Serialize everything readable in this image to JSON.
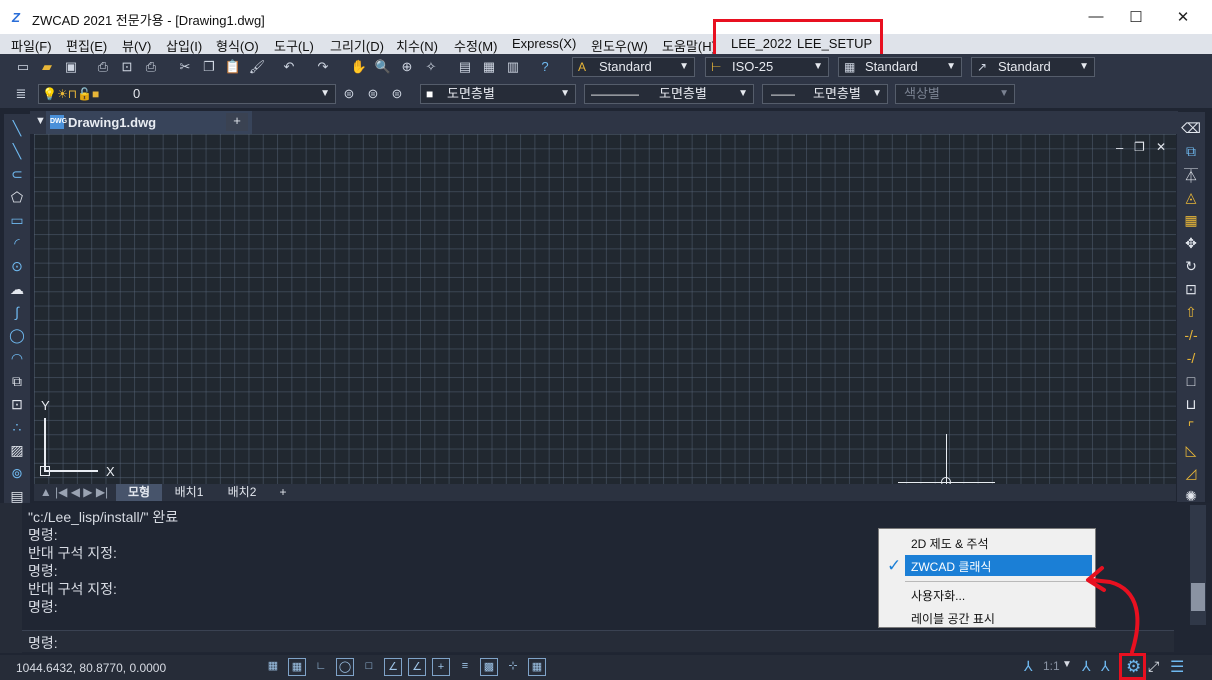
{
  "window": {
    "title": "ZWCAD 2021 전문가용 - [Drawing1.dwg]",
    "min": "—",
    "max": "☐",
    "close": "✕"
  },
  "menu": [
    "파일(F)",
    "편집(E)",
    "뷰(V)",
    "삽입(I)",
    "형식(O)",
    "도구(L)",
    "그리기(D)",
    "치수(N)",
    "수정(M)",
    "Express(X)",
    "윈도우(W)",
    "도움말(H)",
    "LEE_2022",
    "LEE_SETUP"
  ],
  "toolbar1": {
    "text_style": "Standard",
    "dim_style": "ISO-25",
    "table_style": "Standard",
    "mleader_style": "Standard"
  },
  "toolbar2": {
    "layer": "0",
    "color": "도면층별",
    "linetype": "도면층별",
    "lineweight": "도면층별",
    "plotstyle": "색상별"
  },
  "doc_tab": {
    "name": "Drawing1.dwg",
    "close": "✕",
    "new_tab": "+"
  },
  "viewport_controls": {
    "minimize": "–",
    "restore": "❐",
    "close": "✕"
  },
  "ucs": {
    "x": "X",
    "y": "Y"
  },
  "layout_tabs": [
    "모형",
    "배치1",
    "배치2",
    "+"
  ],
  "command_history": [
    "\"c:/Lee_lisp/install/\"  완료",
    "명령:",
    "반대 구석 지정:",
    "명령:",
    "반대 구석 지정:",
    "명령:"
  ],
  "command_prompt": "명령:",
  "status": {
    "coords": "1044.6432, 80.8770, 0.0000",
    "scale": "1:1"
  },
  "context_menu": {
    "items": [
      "2D 제도 & 주석",
      "ZWCAD 클래식",
      "사용자화...",
      "레이블 공간 표시"
    ],
    "checked_index": 1,
    "check": "✓"
  },
  "colors": {
    "accent": "#1b7fd6",
    "highlight": "#e81020",
    "background": "#212830"
  }
}
